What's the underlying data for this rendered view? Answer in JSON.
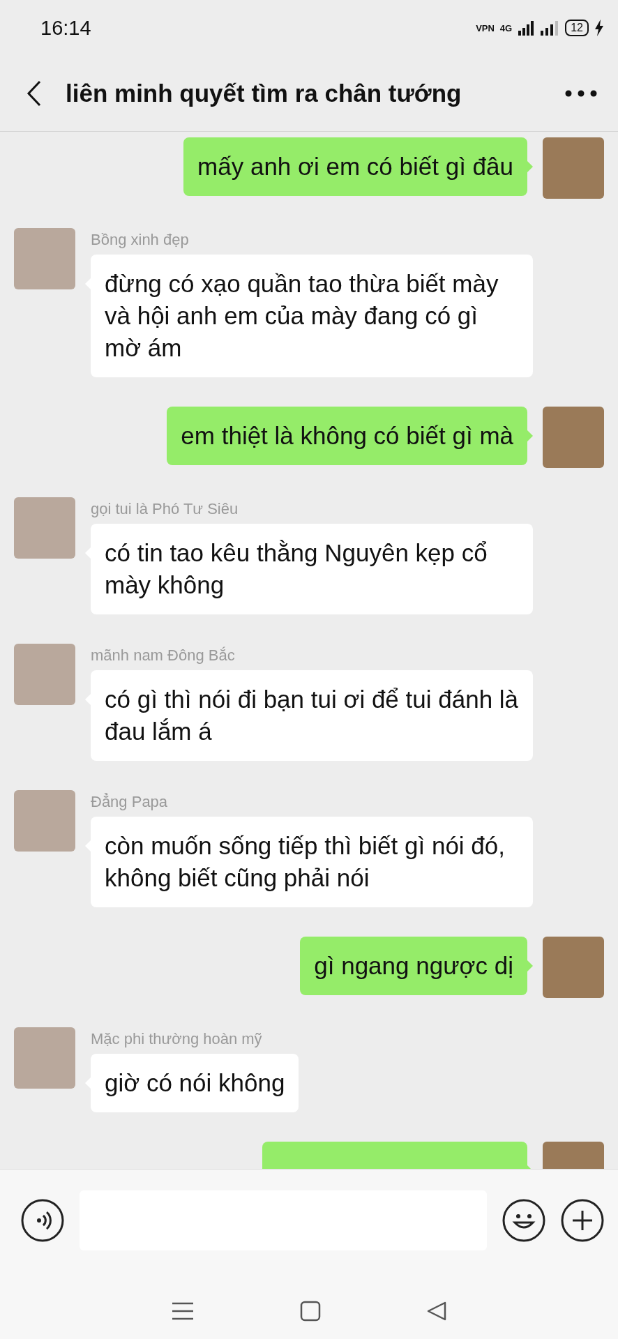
{
  "status_bar": {
    "time": "16:14",
    "vpn": "VPN",
    "network": "4G",
    "battery": "12"
  },
  "header": {
    "title": "liên minh quyết tìm ra chân tướng"
  },
  "messages": [
    {
      "kind": "sent",
      "text": "mấy anh ơi em có biết gì đâu"
    },
    {
      "kind": "received",
      "sender": "Bồng xinh đẹp",
      "text": "đừng có xạo quần tao thừa biết mày và hội anh em của mày đang có gì mờ ám"
    },
    {
      "kind": "sent",
      "text": "em thiệt là không có biết gì mà"
    },
    {
      "kind": "received",
      "sender": "gọi tui là Phó Tư Siêu",
      "text": "có tin tao kêu thằng Nguyên kẹp cổ mày không"
    },
    {
      "kind": "received",
      "sender": "mãnh nam Đông Bắc",
      "text": "có gì thì nói đi bạn tui ơi để tui đánh là đau lắm á"
    },
    {
      "kind": "received",
      "sender": "Đẳng Papa",
      "text": "còn muốn sống tiếp thì biết gì nói đó, không biết cũng phải nói"
    },
    {
      "kind": "sent",
      "text": "gì ngang ngược dị"
    },
    {
      "kind": "received",
      "sender": "Mặc phi thường hoàn mỹ",
      "text": "giờ có nói không"
    },
    {
      "kind": "sent"
    }
  ]
}
